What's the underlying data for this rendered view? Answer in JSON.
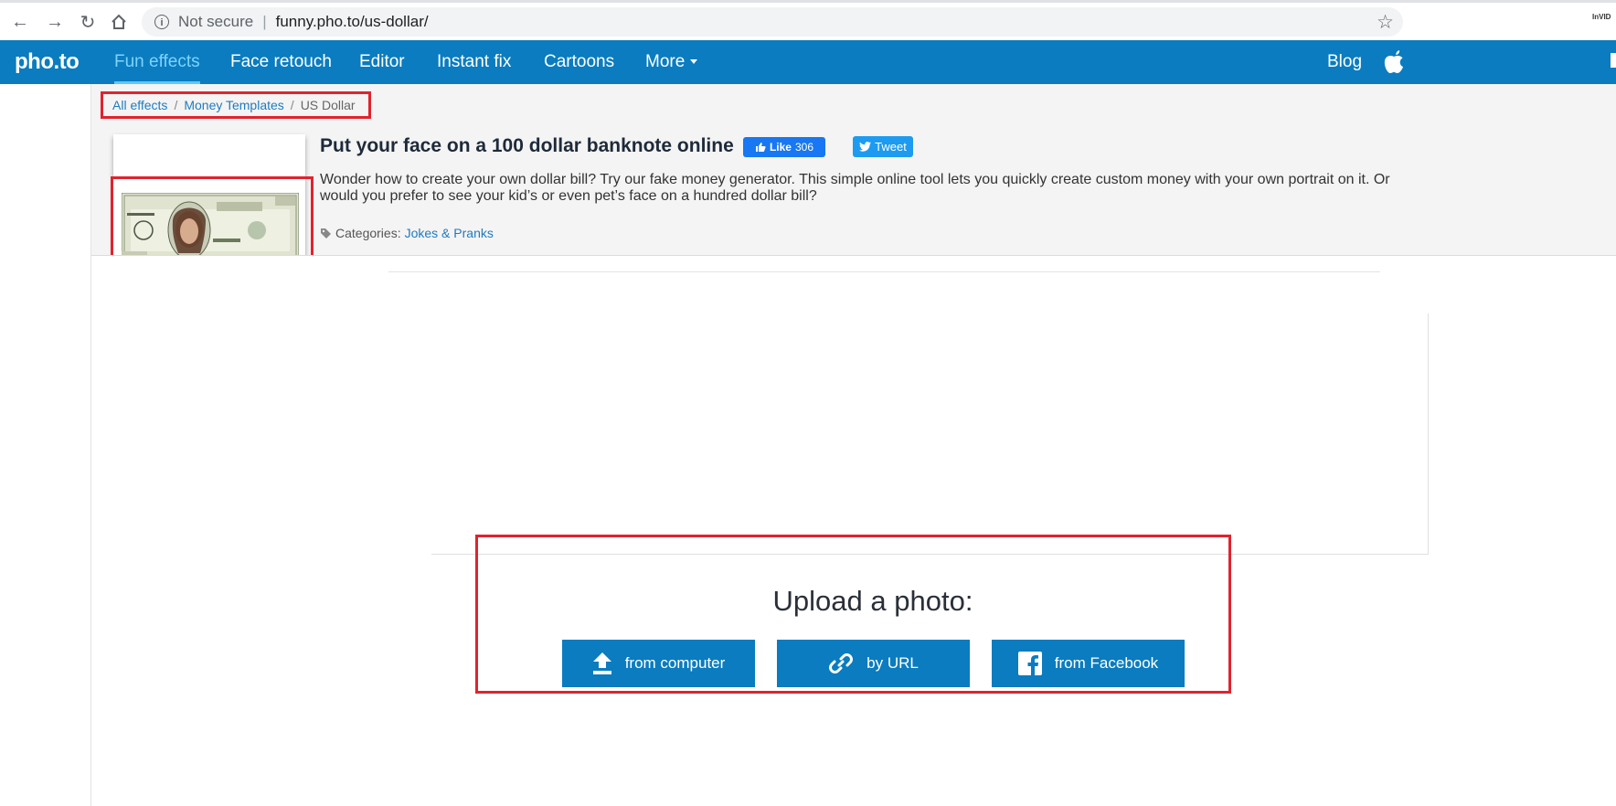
{
  "browser": {
    "security_text": "Not secure",
    "url": "funny.pho.to/us-dollar/",
    "extension_label": "InVID"
  },
  "nav": {
    "logo": "pho.to",
    "items": [
      {
        "label": "Fun effects",
        "active": true
      },
      {
        "label": "Face retouch"
      },
      {
        "label": "Editor"
      },
      {
        "label": "Instant fix"
      },
      {
        "label": "Cartoons"
      },
      {
        "label": "More"
      }
    ],
    "blog": "Blog"
  },
  "breadcrumb": {
    "items": [
      "All effects",
      "Money Templates"
    ],
    "separator": "/",
    "current": "US Dollar"
  },
  "effect": {
    "title": "Put your face on a 100 dollar banknote online",
    "like_label": "Like",
    "like_count": "306",
    "tweet_label": "Tweet",
    "description": "Wonder how to create your own dollar bill? Try our fake money generator. This simple online tool lets you quickly create custom money with your own portrait on it. Or would you prefer to see your kid’s or even pet’s face on a hundred dollar bill?",
    "categories_label": "Categories:",
    "category": "Jokes & Pranks"
  },
  "upload": {
    "title": "Upload a photo:",
    "buttons": [
      "from computer",
      "by URL",
      "from Facebook"
    ]
  },
  "colors": {
    "nav_bg": "#0a7cbf",
    "highlight": "#e0232e",
    "link": "#1f7bbf"
  }
}
